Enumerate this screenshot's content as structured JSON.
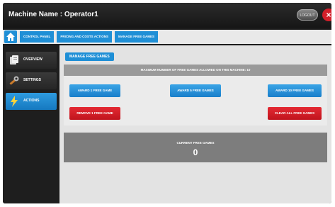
{
  "window": {
    "title": "Machine Name : Operator1"
  },
  "header": {
    "logout_label": "LOGOUT",
    "close_label": "×"
  },
  "breadcrumb": [
    "CONTROL PANEL",
    "PRICING AND COSTS ACTIONS",
    "MANAGE FREE GAMES"
  ],
  "sidebar": {
    "items": [
      {
        "label": "OVERVIEW",
        "icon": "overview-icon"
      },
      {
        "label": "SETTINGS",
        "icon": "settings-icon"
      },
      {
        "label": "ACTIONS",
        "icon": "actions-icon"
      }
    ],
    "active_index": 2
  },
  "main": {
    "section_title": "MANAGE FREE GAMES",
    "max_free_games_text": "MAXIMUM NUMBER OF FREE GAMES ALLOWED ON THIS MACHINE: 10",
    "buttons": {
      "award_1": "AWARD 1 FREE GAME",
      "award_5": "AWARD 5 FREE GAMES",
      "award_10": "AWARD 10 FREE GAMES",
      "remove_1": "REMOVE 1 FREE GAME",
      "clear_all": "CLEAR ALL FREE GAMES"
    },
    "current_label": "CURRENT FREE GAMES",
    "current_value": "0"
  },
  "colors": {
    "accent": "#1f8fd6",
    "danger": "#c8161f",
    "titlebar": "#1c1c1c"
  }
}
